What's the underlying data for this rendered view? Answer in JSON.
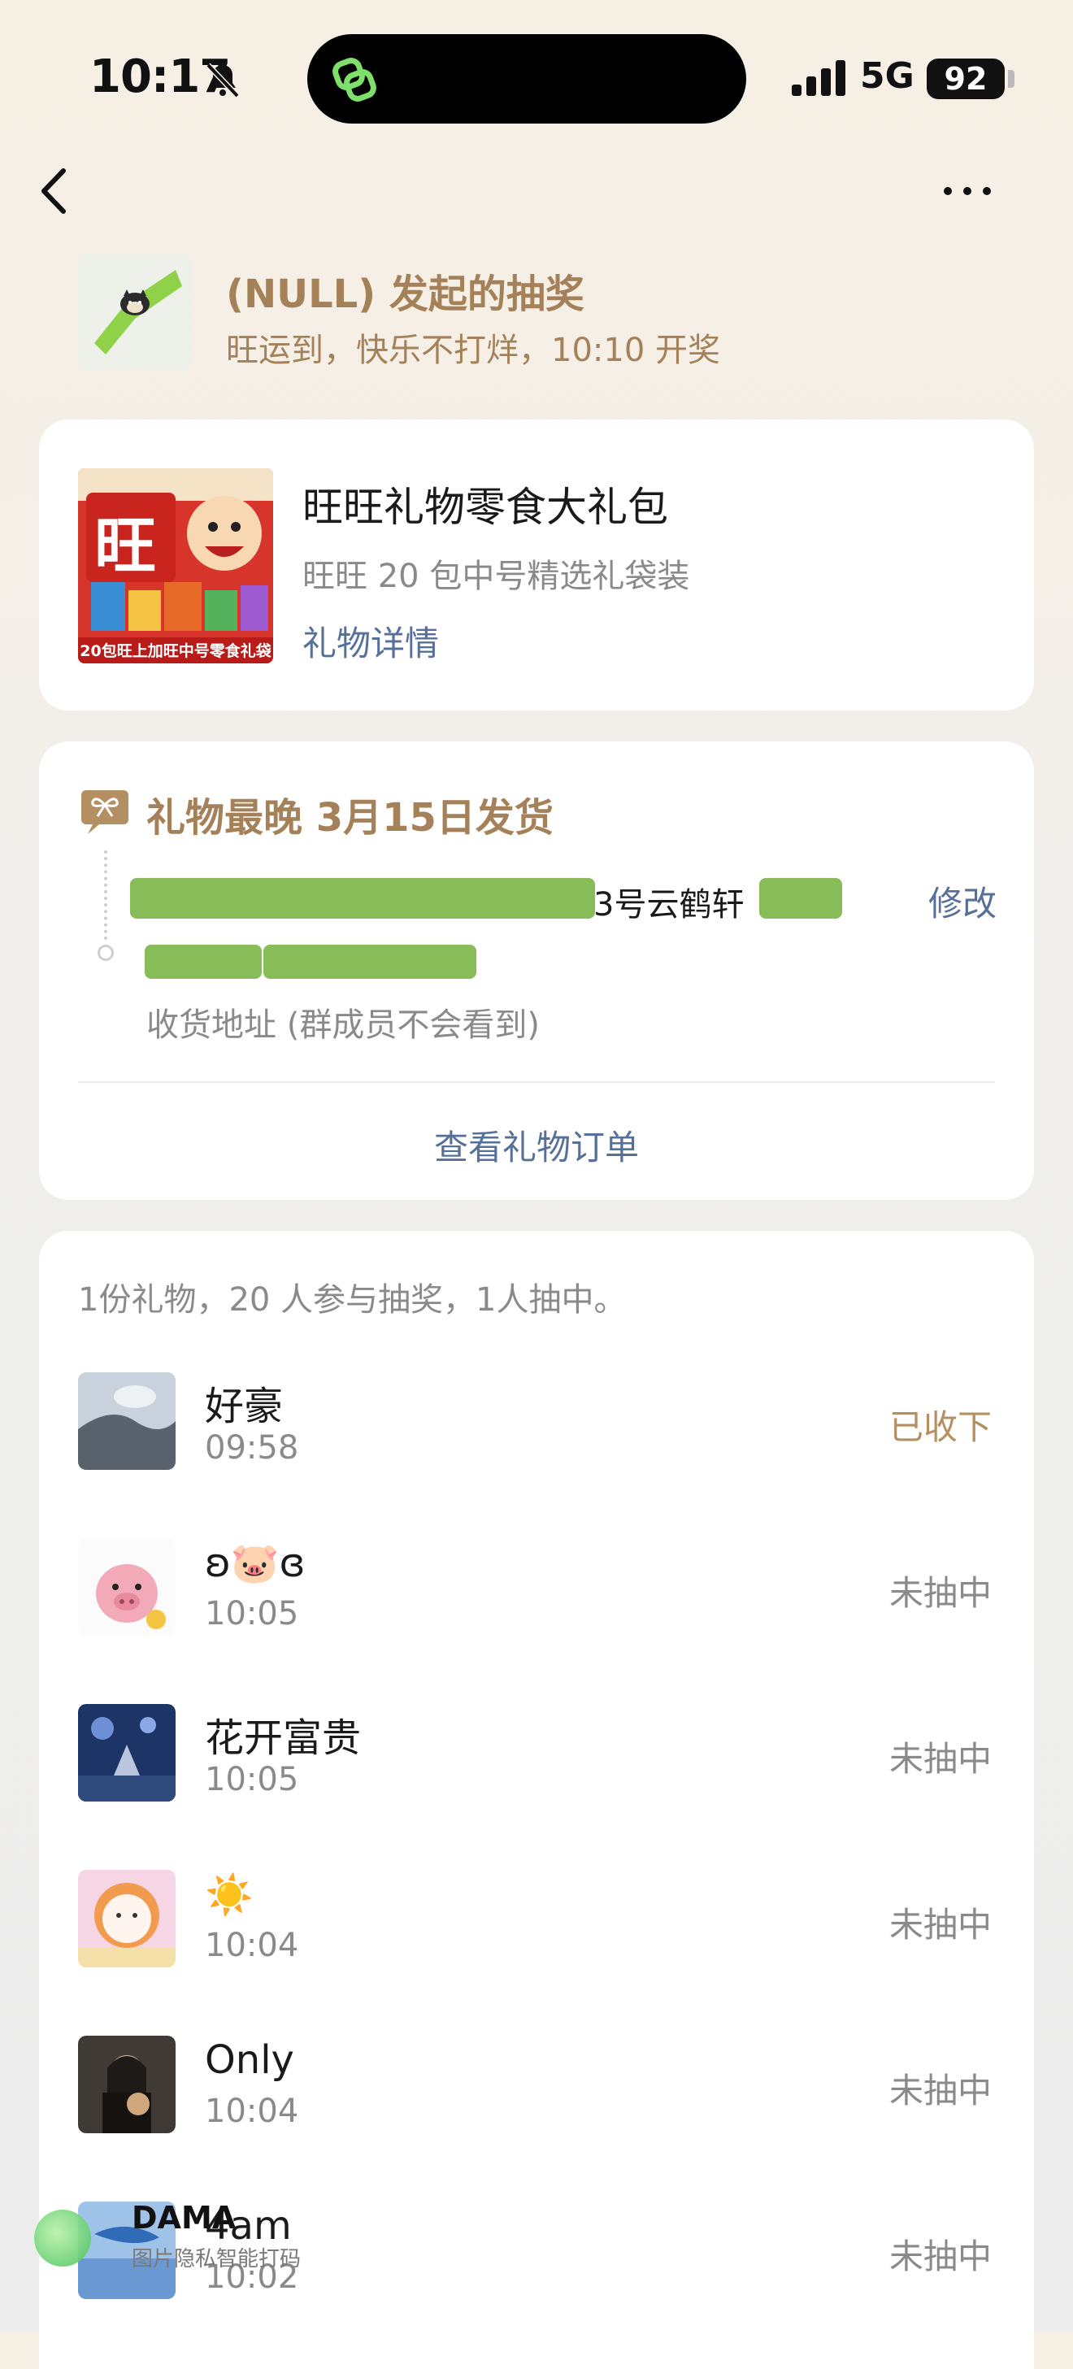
{
  "status_bar": {
    "time": "10:17",
    "network": "5G",
    "battery": "92"
  },
  "header": {
    "host_title": "(NULL) 发起的抽奖",
    "host_subtitle": "旺运到，快乐不打烊，10:10 开奖"
  },
  "gift": {
    "name": "旺旺礼物零食大礼包",
    "spec": "旺旺 20 包中号精选礼袋装",
    "detail_link": "礼物详情",
    "image_caption": "20包旺上加旺中号零食礼袋",
    "image_big_char": "旺"
  },
  "shipping": {
    "title": "礼物最晚 3月15日发货",
    "address_visible": "3号云鹤轩",
    "edit_label": "修改",
    "address_label": "收货地址 (群成员不会看到)",
    "view_order": "查看礼物订单"
  },
  "participants": {
    "summary": "1份礼物，20 人参与抽奖，1人抽中。",
    "rows": [
      {
        "name": "好豪",
        "time": "09:58",
        "status": "已收下",
        "won": true
      },
      {
        "name": "ʚ🐷ɞ",
        "time": "10:05",
        "status": "未抽中",
        "won": false
      },
      {
        "name": "花开富贵",
        "time": "10:05",
        "status": "未抽中",
        "won": false
      },
      {
        "name": "☀️",
        "time": "10:04",
        "status": "未抽中",
        "won": false
      },
      {
        "name": "Only",
        "time": "10:04",
        "status": "未抽中",
        "won": false
      },
      {
        "name": "4am",
        "time": "10:02",
        "status": "未抽中",
        "won": false
      }
    ]
  },
  "watermark": {
    "title": "DAMA",
    "subtitle": "图片隐私智能打码"
  },
  "colors": {
    "accent_gold": "#a48158",
    "link_blue": "#56709a",
    "mask_green": "#88bc58"
  }
}
